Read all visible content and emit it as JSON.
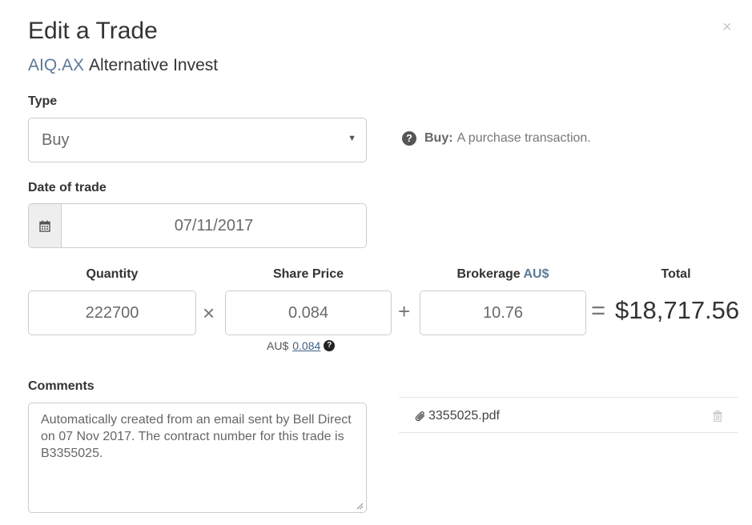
{
  "modal": {
    "title": "Edit a Trade",
    "close_symbol": "×",
    "ticker": "AIQ.AX",
    "company": "Alternative Invest"
  },
  "type_field": {
    "label": "Type",
    "value": "Buy",
    "help_term": "Buy:",
    "help_text": "A purchase transaction."
  },
  "date_field": {
    "label": "Date of trade",
    "value": "07/11/2017"
  },
  "calc": {
    "quantity_label": "Quantity",
    "quantity": "222700",
    "times": "×",
    "price_label": "Share Price",
    "price": "0.084",
    "plus": "+",
    "brokerage_label": "Brokerage",
    "brokerage_currency": "AU$",
    "brokerage": "10.76",
    "equals": "=",
    "total_label": "Total",
    "total": "$18,717.56",
    "converted_currency": "AU$",
    "converted_price": "0.084"
  },
  "comments": {
    "label": "Comments",
    "text": "Automatically created from an email sent by Bell Direct on 07 Nov 2017. The contract number for this trade is B3355025."
  },
  "attachment": {
    "filename": "3355025.pdf"
  },
  "colors": {
    "ticker": "#5b7a98",
    "link": "#3f5f82",
    "border": "#cccccc"
  }
}
